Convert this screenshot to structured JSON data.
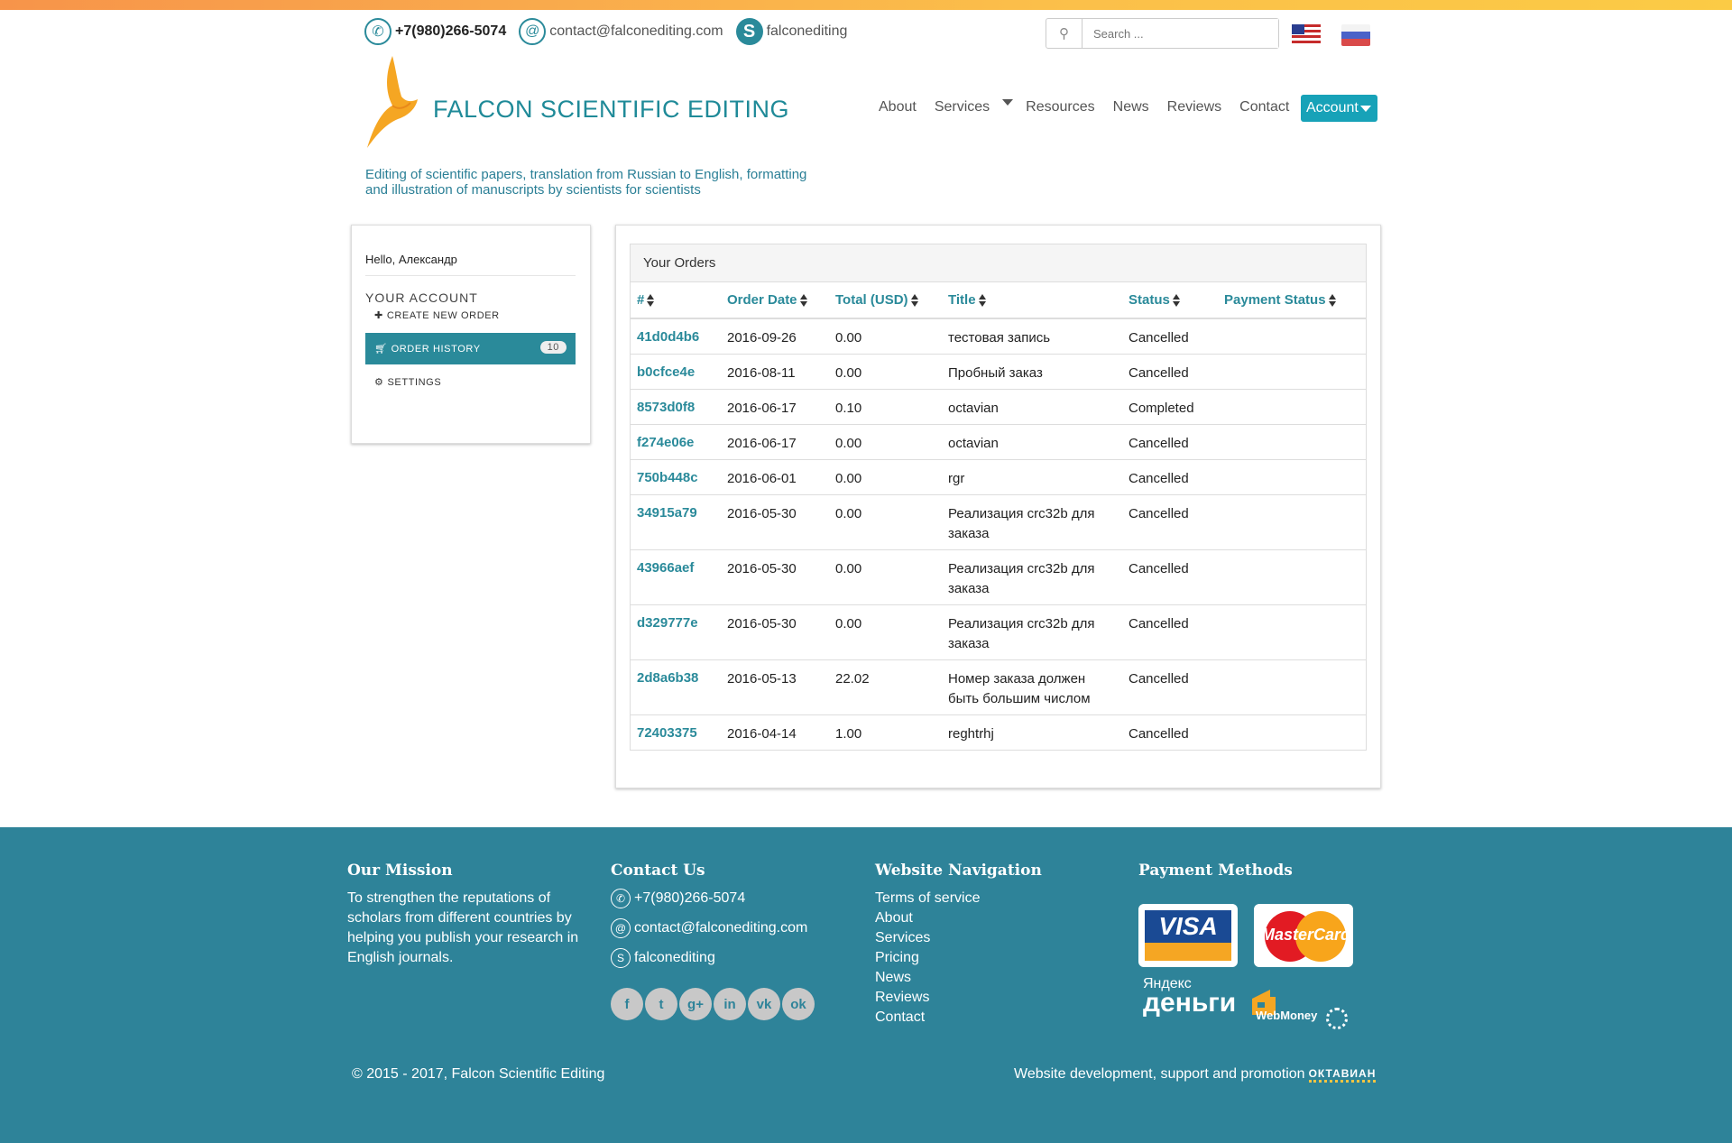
{
  "header": {
    "phone": "+7(980)266-5074",
    "email": "contact@falconediting.com",
    "skype": "falconediting",
    "search_placeholder": "Search ...",
    "brand": "FALCON SCIENTIFIC EDITING",
    "tagline_line1": "Editing of scientific papers, translation from Russian to English, formatting",
    "tagline_line2": "and illustration of manuscripts by scientists for scientists"
  },
  "nav": {
    "items": [
      "About",
      "Services",
      "Resources",
      "News",
      "Reviews",
      "Contact"
    ],
    "account": "Account"
  },
  "sidebar": {
    "hello": "Hello, Александр",
    "section": "YOUR ACCOUNT",
    "items": [
      {
        "label": "CREATE NEW ORDER",
        "icon": "plus-icon"
      },
      {
        "label": "ORDER HISTORY",
        "icon": "cart-icon",
        "badge": "10"
      },
      {
        "label": "SETTINGS",
        "icon": "gear-icon"
      }
    ]
  },
  "orders": {
    "heading": "Your Orders",
    "columns": [
      "#",
      "Order Date",
      "Total (USD)",
      "Title",
      "Status",
      "Payment Status"
    ],
    "rows": [
      {
        "id": "41d0d4b6",
        "date": "2016-09-26",
        "total": "0.00",
        "title": "тестовая запись",
        "status": "Cancelled",
        "payment": ""
      },
      {
        "id": "b0cfce4e",
        "date": "2016-08-11",
        "total": "0.00",
        "title": "Пробный заказ",
        "status": "Cancelled",
        "payment": ""
      },
      {
        "id": "8573d0f8",
        "date": "2016-06-17",
        "total": "0.10",
        "title": "octavian",
        "status": "Completed",
        "payment": ""
      },
      {
        "id": "f274e06e",
        "date": "2016-06-17",
        "total": "0.00",
        "title": "octavian",
        "status": "Cancelled",
        "payment": ""
      },
      {
        "id": "750b448c",
        "date": "2016-06-01",
        "total": "0.00",
        "title": "rgr",
        "status": "Cancelled",
        "payment": ""
      },
      {
        "id": "34915a79",
        "date": "2016-05-30",
        "total": "0.00",
        "title": "Реализация crc32b для заказа",
        "status": "Cancelled",
        "payment": ""
      },
      {
        "id": "43966aef",
        "date": "2016-05-30",
        "total": "0.00",
        "title": "Реализация crc32b для заказа",
        "status": "Cancelled",
        "payment": ""
      },
      {
        "id": "d329777e",
        "date": "2016-05-30",
        "total": "0.00",
        "title": "Реализация crc32b для заказа",
        "status": "Cancelled",
        "payment": ""
      },
      {
        "id": "2d8a6b38",
        "date": "2016-05-13",
        "total": "22.02",
        "title": "Номер заказа должен быть большим числом",
        "status": "Cancelled",
        "payment": ""
      },
      {
        "id": "72403375",
        "date": "2016-04-14",
        "total": "1.00",
        "title": "reghtrhj",
        "status": "Cancelled",
        "payment": ""
      }
    ]
  },
  "footer": {
    "mission_title": "Our Mission",
    "mission_text": "To strengthen the reputations of scholars from different countries by helping you publish your research in English journals.",
    "contact_title": "Contact Us",
    "phone": "+7(980)266-5074",
    "email": "contact@falconediting.com",
    "skype": "falconediting",
    "nav_title": "Website Navigation",
    "nav_links": [
      "Terms of service",
      "About",
      "Services",
      "Pricing",
      "News",
      "Reviews",
      "Contact"
    ],
    "payment_title": "Payment Methods",
    "visa": "VISA",
    "mastercard": "MasterCard",
    "yandex_small": "Яндекс",
    "yandex_big": "деньги",
    "webmoney": "WebMoney",
    "copyright": "© 2015 - 2017, Falcon Scientific Editing",
    "dev_text": "Website development, support and promotion",
    "dev_brand": "ОКТАВИАН"
  },
  "colors": {
    "accent": "#2a8a9a",
    "footer": "#2e8399",
    "account_button": "#17a2b8",
    "top_gradient": "#f9a94c"
  }
}
